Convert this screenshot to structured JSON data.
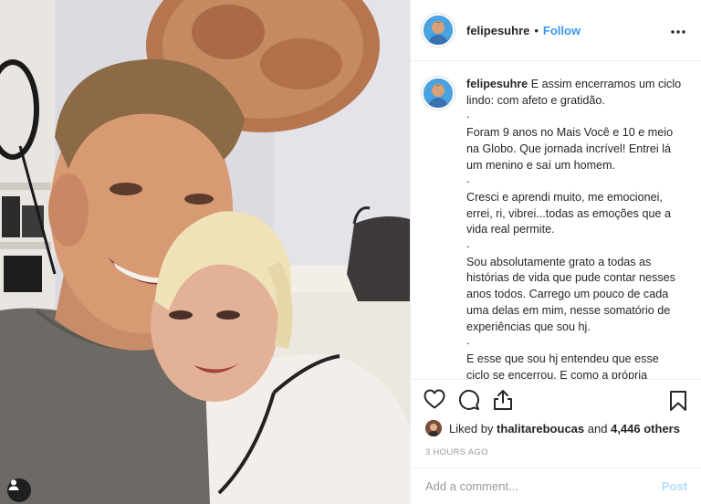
{
  "post": {
    "username": "felipesuhre",
    "follow_label": "Follow",
    "separator": "•",
    "more_icon": "more-options-icon"
  },
  "caption": {
    "username": "felipesuhre",
    "paragraphs": [
      "E assim encerramos um ciclo lindo: com afeto e gratidão.",
      ".",
      "Foram 9 anos no Mais Você e 10 e meio na Globo. Que jornada incrível! Entrei lá um menino e saí um homem.",
      ".",
      "Cresci e aprendi muito, me emocionei, errei, ri, vibrei...todas as emoções que a vida real permite.",
      ".",
      "Sou absolutamente grato a todas as histórias de vida que pude contar nesses anos todos. Carrego um pouco de cada uma delas em mim, nesse somatório de experiências que sou hj.",
      ".",
      "E esse que sou hj entendeu que esse ciclo se encerrou. E como a própria"
    ]
  },
  "actions": {
    "like_icon": "heart-icon",
    "comment_icon": "comment-icon",
    "share_icon": "share-icon",
    "save_icon": "bookmark-icon"
  },
  "likes": {
    "prefix": "Liked by",
    "user": "thalitareboucas",
    "connector": "and",
    "count": "4,446 others"
  },
  "timestamp": "3 HOURS AGO",
  "comment": {
    "placeholder": "Add a comment...",
    "post_label": "Post"
  },
  "colors": {
    "link_blue": "#3897f0",
    "post_disabled": "#b3dbff",
    "border": "#efefef",
    "muted": "#999999"
  }
}
